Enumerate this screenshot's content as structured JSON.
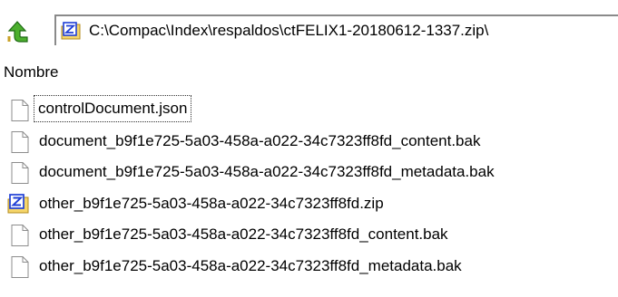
{
  "address_bar": {
    "up_icon": "green-up-arrow-icon",
    "path_icon": "zip-archive-icon",
    "path": "C:\\Compac\\Index\\respaldos\\ctFELIX1-20180612-1337.zip\\"
  },
  "columns": {
    "name_header": "Nombre"
  },
  "files": [
    {
      "name": "controlDocument.json",
      "icon": "blank-file-icon",
      "focused": true
    },
    {
      "name": "document_b9f1e725-5a03-458a-a022-34c7323ff8fd_content.bak",
      "icon": "blank-file-icon",
      "focused": false
    },
    {
      "name": "document_b9f1e725-5a03-458a-a022-34c7323ff8fd_metadata.bak",
      "icon": "blank-file-icon",
      "focused": false
    },
    {
      "name": "other_b9f1e725-5a03-458a-a022-34c7323ff8fd.zip",
      "icon": "zip-archive-icon",
      "focused": false
    },
    {
      "name": "other_b9f1e725-5a03-458a-a022-34c7323ff8fd_content.bak",
      "icon": "blank-file-icon",
      "focused": false
    },
    {
      "name": "other_b9f1e725-5a03-458a-a022-34c7323ff8fd_metadata.bak",
      "icon": "blank-file-icon",
      "focused": false
    }
  ],
  "colors": {
    "zip_icon_blue": "#1f3fd6",
    "zip_icon_yellow": "#f2c94c",
    "up_arrow_green": "#3a9a2a"
  }
}
